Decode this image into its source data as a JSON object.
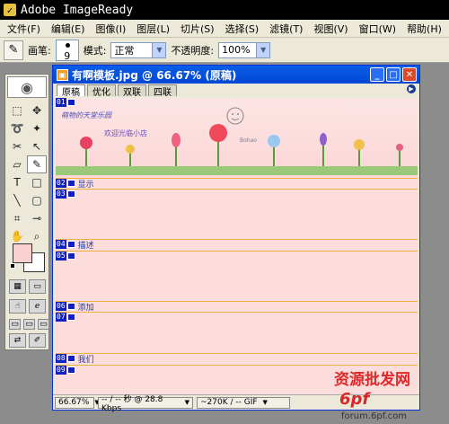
{
  "app": {
    "title": "Adobe ImageReady",
    "icon": "imageready-logo-icon"
  },
  "menu": [
    "文件(F)",
    "编辑(E)",
    "图像(I)",
    "图层(L)",
    "切片(S)",
    "选择(S)",
    "滤镜(T)",
    "视图(V)",
    "窗口(W)",
    "帮助(H)"
  ],
  "options": {
    "brush_label": "画笔:",
    "brush_size": "9",
    "mode_label": "模式:",
    "mode_value": "正常",
    "opacity_label": "不透明度:",
    "opacity_value": "100%"
  },
  "document": {
    "title": "有啊模板.jpg @ 66.67% (原稿)",
    "tabs": [
      "原稿",
      "优化",
      "双联",
      "四联"
    ],
    "banner": {
      "line1": "萌物的天堂乐园",
      "line2": "欢迎光临小店",
      "line3": "Bohao"
    },
    "slices": [
      {
        "num": "01",
        "label": ""
      },
      {
        "num": "02",
        "label": "显示"
      },
      {
        "num": "03",
        "label": ""
      },
      {
        "num": "04",
        "label": "描述"
      },
      {
        "num": "05",
        "label": ""
      },
      {
        "num": "06",
        "label": "添加"
      },
      {
        "num": "07",
        "label": ""
      },
      {
        "num": "08",
        "label": "我们"
      },
      {
        "num": "09",
        "label": ""
      }
    ],
    "status": {
      "zoom": "66.67%",
      "download": "-- / -- 秒 @ 28.8 Kbps",
      "size": "~270K / -- GIF"
    }
  },
  "watermark": {
    "line1": "资源批发网",
    "line2": "6pf",
    "line3": "forum.6pf.com"
  },
  "colors": {
    "foreground": "#f8d0d0",
    "background": "#ffffff",
    "slice_tag": "#1020c0",
    "slice_line": "#f0b040"
  }
}
